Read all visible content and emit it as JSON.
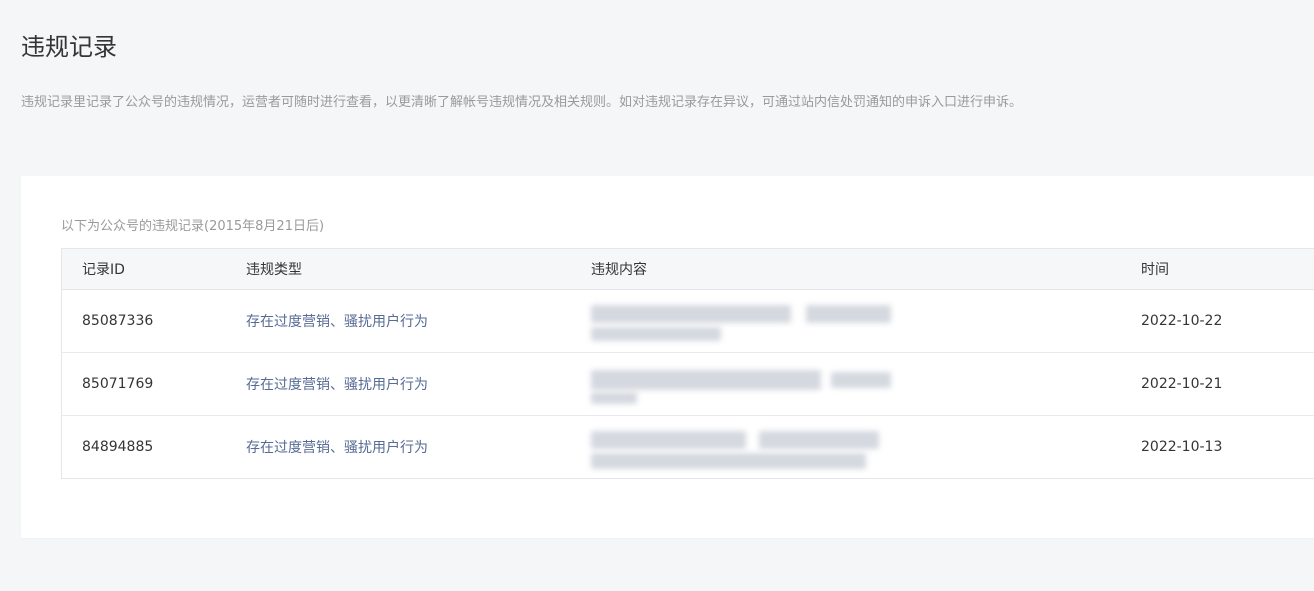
{
  "page": {
    "title": "违规记录",
    "description": "违规记录里记录了公众号的违规情况，运营者可随时进行查看，以更清晰了解帐号违规情况及相关规则。如对违规记录存在异议，可通过站内信处罚通知的申诉入口进行申诉。"
  },
  "records": {
    "caption": "以下为公众号的违规记录(2015年8月21日后)",
    "columns": {
      "id": "记录ID",
      "type": "违规类型",
      "content": "违规内容",
      "time": "时间"
    },
    "rows": [
      {
        "id": "85087336",
        "type": "存在过度营销、骚扰用户行为",
        "time": "2022-10-22"
      },
      {
        "id": "85071769",
        "type": "存在过度营销、骚扰用户行为",
        "time": "2022-10-21"
      },
      {
        "id": "84894885",
        "type": "存在过度营销、骚扰用户行为",
        "time": "2022-10-13"
      }
    ]
  }
}
